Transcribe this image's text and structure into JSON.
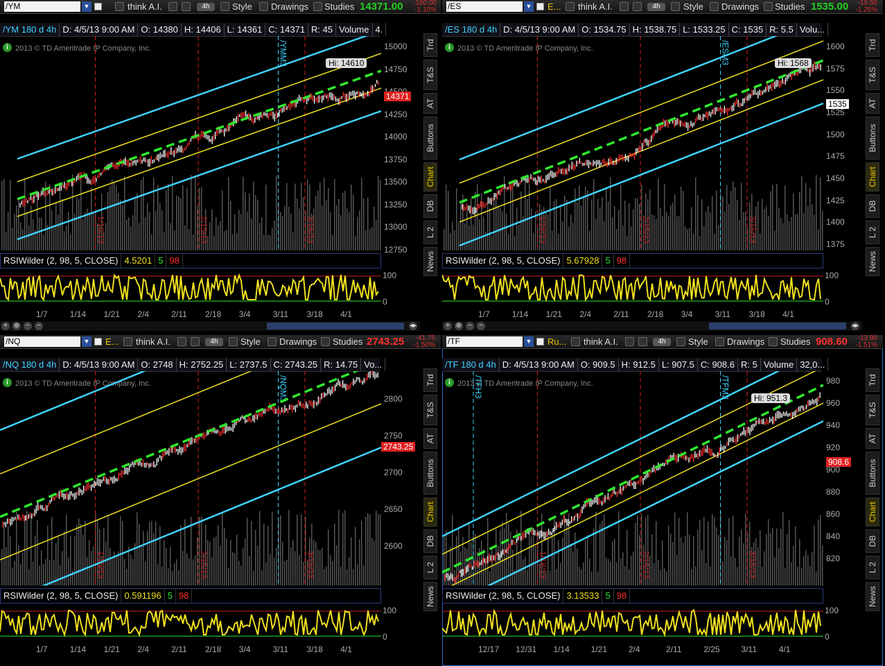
{
  "toolbar": {
    "think": "think A.I.",
    "agg": "4h",
    "style": "Style",
    "drawings": "Drawings",
    "studies": "Studies"
  },
  "side_tabs": [
    "Trd",
    "T&S",
    "AT",
    "Buttons",
    "Chart",
    "DB",
    "L 2",
    "News"
  ],
  "colors": {
    "channel_outer": "#3fd2ff",
    "channel_inner": "#f0e020",
    "regression": "#2ee82e",
    "rsi_line": "#f0e020",
    "price_up": "#00e000",
    "price_down": "#ff3030"
  },
  "panels": [
    {
      "id": "ym",
      "symbol": "/YM",
      "last": "14371.00",
      "chg": "-160.00",
      "pct": "-1.10%",
      "price_color": "#21d021",
      "info": [
        "/YM 180 d 4h",
        "D: 4/5/13 9:00 AM",
        "O: 14380",
        "H: 14406",
        "L: 14361",
        "C: 14371",
        "R: 45",
        "Volume",
        "4."
      ],
      "copyright": "2013 © TD Ameritrade IP Company, Inc.",
      "hi": "Hi: 14610",
      "last_tag": "14371",
      "y_labels": [
        "15000",
        "14750",
        "14500",
        "14250",
        "14000",
        "13750",
        "13500",
        "13250",
        "13000",
        "12750"
      ],
      "x_labels": [
        "1/7",
        "1/14",
        "1/21",
        "2/4",
        "2/11",
        "2/18",
        "3/4",
        "3/11",
        "3/18",
        "4/1"
      ],
      "contract": "/YMM3",
      "vlines": [
        "1/16/13",
        "2/15/13",
        "3/15/13"
      ],
      "rsi": [
        "RSIWilder (2, 98, 5, CLOSE)",
        "4.5201",
        "5",
        "98"
      ],
      "rsi_levels": [
        "100",
        "0"
      ]
    },
    {
      "id": "es",
      "symbol": "/ES",
      "desc": "E...",
      "last": "1535.00",
      "chg": "-19.50",
      "pct": "-1.25%",
      "price_color": "#21d021",
      "info": [
        "/ES 180 d 4h",
        "D: 4/5/13 9:00 AM",
        "O: 1534.75",
        "H: 1538.75",
        "L: 1533.25",
        "C: 1535",
        "R: 5.5",
        "Volu..."
      ],
      "copyright": "2013 © TD Ameritrade IP Company, Inc.",
      "hi": "Hi: 1568",
      "last_tag": "1535",
      "y_labels": [
        "1600",
        "1575",
        "1550",
        "1525",
        "1500",
        "1475",
        "1450",
        "1425",
        "1400",
        "1375"
      ],
      "x_labels": [
        "1/7",
        "1/14",
        "1/21",
        "2/4",
        "2/11",
        "2/18",
        "3/4",
        "3/11",
        "3/18",
        "4/1"
      ],
      "contract": "/ESM3",
      "vlines": [
        "1/16/13",
        "2/15/13",
        "3/15/13"
      ],
      "rsi": [
        "RSIWilder (2, 98, 5, CLOSE)",
        "5.67928",
        "5",
        "98"
      ],
      "rsi_levels": [
        "100",
        "0"
      ]
    },
    {
      "id": "nq",
      "symbol": "/NQ",
      "desc": "E...",
      "last": "2743.25",
      "chg": "-41.75",
      "pct": "-1.50%",
      "price_color": "#ff3030",
      "info": [
        "/NQ 180 d 4h",
        "D: 4/5/13 9:00 AM",
        "O: 2748",
        "H: 2752.25",
        "L: 2737.5",
        "C: 2743.25",
        "R: 14.75",
        "Vo..."
      ],
      "copyright": "2013 © TD Ameritrade IP Company, Inc.",
      "hi": "",
      "last_tag": "2743.25",
      "y_labels": [
        "2800",
        "2750",
        "2700",
        "2650",
        "2600"
      ],
      "x_labels": [
        "1/7",
        "1/14",
        "1/21",
        "2/4",
        "2/11",
        "2/18",
        "3/4",
        "3/11",
        "3/18",
        "4/1"
      ],
      "contract": "/NQM3",
      "vlines": [
        "1/16/13",
        "2/15/13",
        "3/15/13"
      ],
      "rsi": [
        "RSIWilder (2, 98, 5, CLOSE)",
        "0.591196",
        "5",
        "98"
      ],
      "rsi_levels": [
        "100",
        "0"
      ]
    },
    {
      "id": "tf",
      "symbol": "/TF",
      "desc": "Ru...",
      "last": "908.60",
      "chg": "-13.90",
      "pct": "-1.51%",
      "price_color": "#ff3030",
      "info": [
        "/TF 180 d 4h",
        "D: 4/5/13 9:00 AM",
        "O: 909.5",
        "H: 912.5",
        "L: 907.5",
        "C: 908.6",
        "R: 5",
        "Volume",
        "32,0..."
      ],
      "copyright": "2013 © TD Ameritrade IP Company, Inc.",
      "hi": "Hi: 951.3",
      "last_tag": "908.6",
      "y_labels": [
        "980",
        "960",
        "940",
        "920",
        "900",
        "880",
        "860",
        "840",
        "820"
      ],
      "x_labels": [
        "12/17",
        "12/31",
        "1/14",
        "1/21",
        "2/4",
        "2/11",
        "2/25",
        "3/11",
        "4/1"
      ],
      "contract": "/TFM3",
      "contract2": "/TFH3",
      "vlines": [
        "1/18/13",
        "2/15/13",
        "3/15/13"
      ],
      "rsi": [
        "RSIWilder (2, 98, 5, CLOSE)",
        "3.13533",
        "5",
        "98"
      ],
      "rsi_levels": [
        "100",
        "0"
      ]
    }
  ]
}
